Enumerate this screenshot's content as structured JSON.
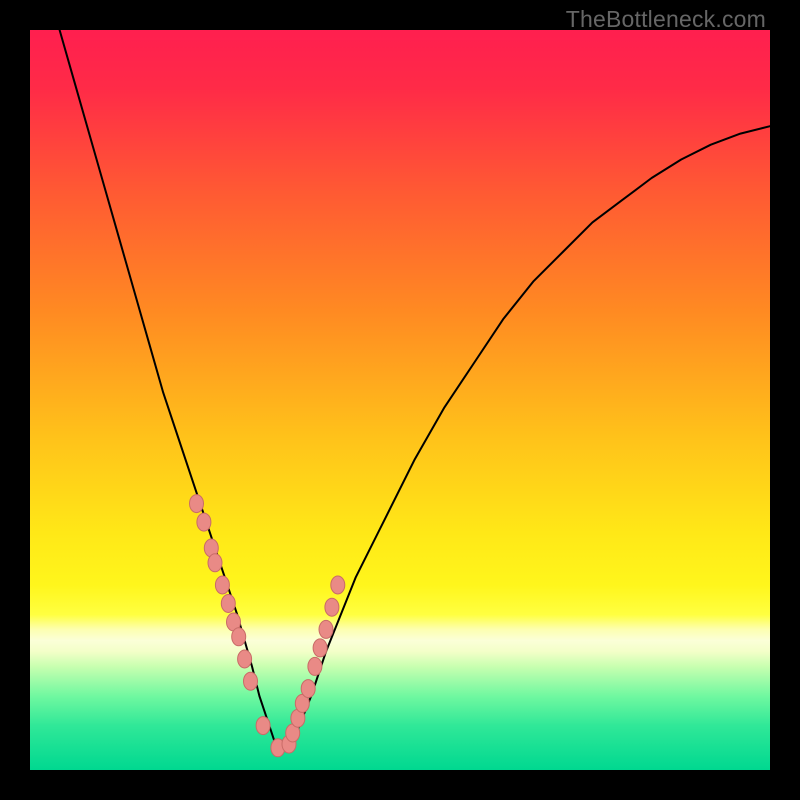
{
  "watermark": "TheBottleneck.com",
  "colors": {
    "curve": "#000000",
    "point_fill": "#e98a86",
    "point_stroke": "#c96b67"
  },
  "chart_data": {
    "type": "line",
    "title": "",
    "xlabel": "",
    "ylabel": "",
    "xlim": [
      0,
      100
    ],
    "ylim": [
      0,
      100
    ],
    "curve": {
      "x": [
        4,
        6,
        8,
        10,
        12,
        14,
        16,
        18,
        20,
        22,
        24,
        26,
        28,
        30,
        31,
        32,
        33,
        34,
        36,
        38,
        40,
        44,
        48,
        52,
        56,
        60,
        64,
        68,
        72,
        76,
        80,
        84,
        88,
        92,
        96,
        100
      ],
      "values": [
        100,
        93,
        86,
        79,
        72,
        65,
        58,
        51,
        45,
        39,
        33,
        27,
        21,
        14,
        10,
        7,
        4,
        3,
        5,
        10,
        16,
        26,
        34,
        42,
        49,
        55,
        61,
        66,
        70,
        74,
        77,
        80,
        82.5,
        84.5,
        86,
        87
      ]
    },
    "series": [
      {
        "name": "scatter-points",
        "x": [
          22.5,
          23.5,
          24.5,
          25,
          26,
          26.8,
          27.5,
          28.2,
          29,
          29.8,
          31.5,
          33.5,
          35,
          35.5,
          36.2,
          36.8,
          37.6,
          38.5,
          39.2,
          40,
          40.8,
          41.6
        ],
        "values": [
          36,
          33.5,
          30,
          28,
          25,
          22.5,
          20,
          18,
          15,
          12,
          6,
          3,
          3.5,
          5,
          7,
          9,
          11,
          14,
          16.5,
          19,
          22,
          25
        ]
      }
    ]
  }
}
